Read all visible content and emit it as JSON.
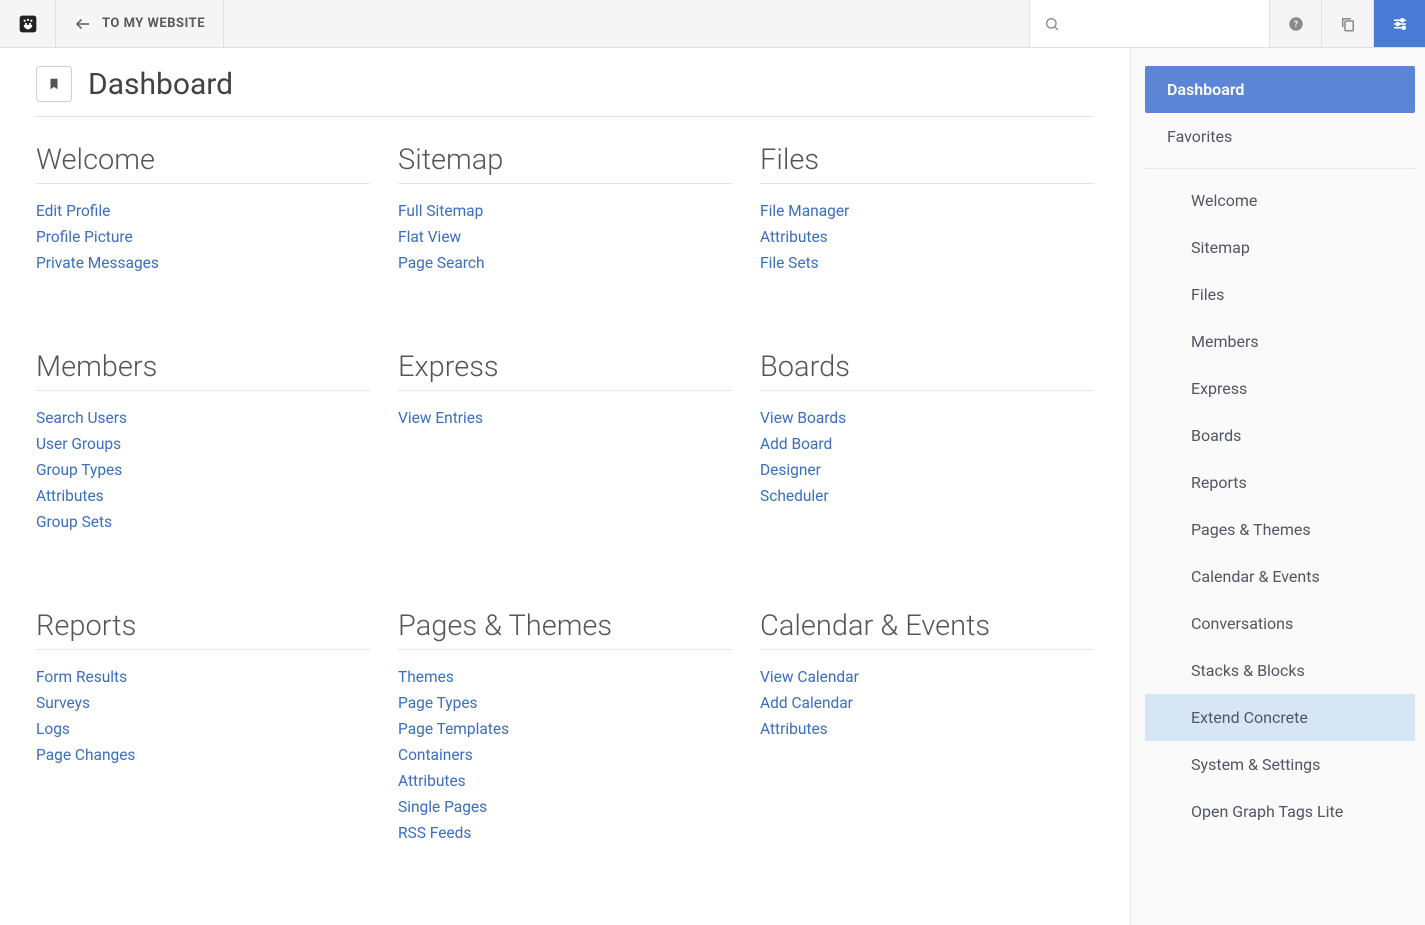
{
  "toolbar": {
    "back_label": "TO MY WEBSITE",
    "search_placeholder": ""
  },
  "page": {
    "title": "Dashboard"
  },
  "sections": [
    {
      "heading": "Welcome",
      "links": [
        "Edit Profile",
        "Profile Picture",
        "Private Messages"
      ]
    },
    {
      "heading": "Sitemap",
      "links": [
        "Full Sitemap",
        "Flat View",
        "Page Search"
      ]
    },
    {
      "heading": "Files",
      "links": [
        "File Manager",
        "Attributes",
        "File Sets"
      ]
    },
    {
      "heading": "Members",
      "links": [
        "Search Users",
        "User Groups",
        "Group Types",
        "Attributes",
        "Group Sets"
      ]
    },
    {
      "heading": "Express",
      "links": [
        "View Entries"
      ]
    },
    {
      "heading": "Boards",
      "links": [
        "View Boards",
        "Add Board",
        "Designer",
        "Scheduler"
      ]
    },
    {
      "heading": "Reports",
      "links": [
        "Form Results",
        "Surveys",
        "Logs",
        "Page Changes"
      ]
    },
    {
      "heading": "Pages & Themes",
      "links": [
        "Themes",
        "Page Types",
        "Page Templates",
        "Containers",
        "Attributes",
        "Single Pages",
        "RSS Feeds"
      ]
    },
    {
      "heading": "Calendar & Events",
      "links": [
        "View Calendar",
        "Add Calendar",
        "Attributes"
      ]
    }
  ],
  "sidebar": {
    "top": [
      {
        "label": "Dashboard",
        "active": true
      },
      {
        "label": "Favorites",
        "active": false
      }
    ],
    "nav": [
      {
        "label": "Welcome"
      },
      {
        "label": "Sitemap"
      },
      {
        "label": "Files"
      },
      {
        "label": "Members"
      },
      {
        "label": "Express"
      },
      {
        "label": "Boards"
      },
      {
        "label": "Reports"
      },
      {
        "label": "Pages & Themes"
      },
      {
        "label": "Calendar & Events"
      },
      {
        "label": "Conversations"
      },
      {
        "label": "Stacks & Blocks"
      },
      {
        "label": "Extend Concrete",
        "highlight": true
      },
      {
        "label": "System & Settings"
      },
      {
        "label": "Open Graph Tags Lite"
      }
    ]
  }
}
